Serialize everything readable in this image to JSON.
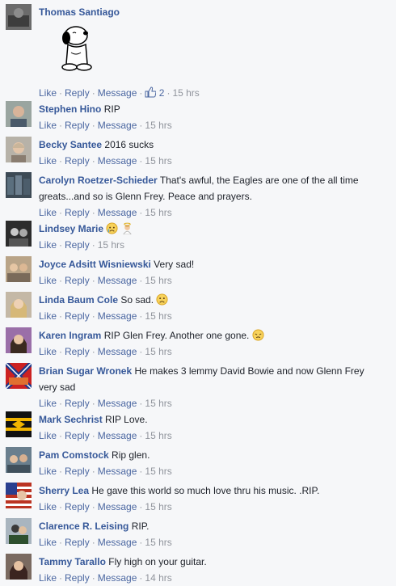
{
  "actions": {
    "like": "Like",
    "reply": "Reply",
    "message": "Message",
    "sep": "·"
  },
  "comments": [
    {
      "author": "Thomas Santiago",
      "text": "",
      "likes": "2",
      "time": "15 hrs",
      "sticker": "snoopy-sticker"
    },
    {
      "author": "Stephen Hino",
      "text": "RIP",
      "time": "15 hrs"
    },
    {
      "author": "Becky Santee",
      "text": "2016 sucks",
      "time": "15 hrs"
    },
    {
      "author": "Carolyn Roetzer-Schieder",
      "text": "That's awful, the Eagles are one of the all time",
      "text2": "greats...and so is Glenn Frey. Peace and prayers.",
      "time": "15 hrs"
    },
    {
      "author": "Lindsey Marie",
      "text": "",
      "time": "15 hrs",
      "emojis": [
        "crying-face-icon",
        "angel-icon"
      ]
    },
    {
      "author": "Joyce Adsitt Wisniewski",
      "text": "Very sad!",
      "time": "15 hrs"
    },
    {
      "author": "Linda Baum Cole",
      "text": "So sad.",
      "time": "15 hrs",
      "emojis": [
        "frowning-face-icon"
      ]
    },
    {
      "author": "Karen Ingram",
      "text": "RIP Glen Frey. Another one gone.",
      "time": "15 hrs",
      "emojis": [
        "sad-face-icon"
      ]
    },
    {
      "author": "Brian Sugar Wronek",
      "text": "He makes 3 lemmy David Bowie and now Glenn Frey",
      "text2": "very sad",
      "time": "15 hrs"
    },
    {
      "author": "Mark Sechrist",
      "text": "RIP Love.",
      "time": "15 hrs"
    },
    {
      "author": "Pam Comstock",
      "text": "Rip glen.",
      "time": "15 hrs"
    },
    {
      "author": "Sherry Lea",
      "text": "He gave this world so much love thru his music. .RIP.",
      "time": "15 hrs"
    },
    {
      "author": "Clarence R. Leising",
      "text": "RIP.",
      "time": "15 hrs"
    },
    {
      "author": "Tammy Tarallo",
      "text": "Fly high on your guitar.",
      "time": "14 hrs"
    }
  ],
  "colors": {
    "author": "#365899",
    "link": "#4b67a1",
    "meta": "#90949c",
    "background": "#f6f7f9"
  }
}
